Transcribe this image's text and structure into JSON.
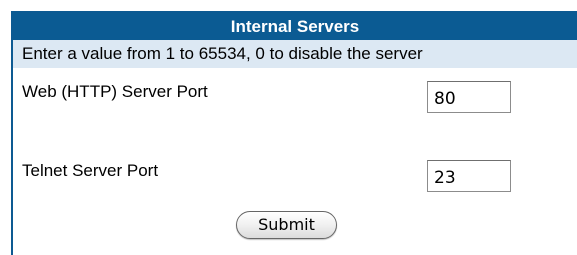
{
  "header": {
    "title": "Internal Servers"
  },
  "info": {
    "text": "Enter a value from 1 to 65534, 0 to disable the server"
  },
  "fields": [
    {
      "label": "Web (HTTP) Server Port",
      "value": "80"
    },
    {
      "label": "Telnet Server Port",
      "value": "23"
    }
  ],
  "submit": {
    "label": "Submit"
  },
  "colors": {
    "header_bg": "#0b5b93",
    "info_bg": "#dce8f3",
    "border": "#0d5a92"
  }
}
